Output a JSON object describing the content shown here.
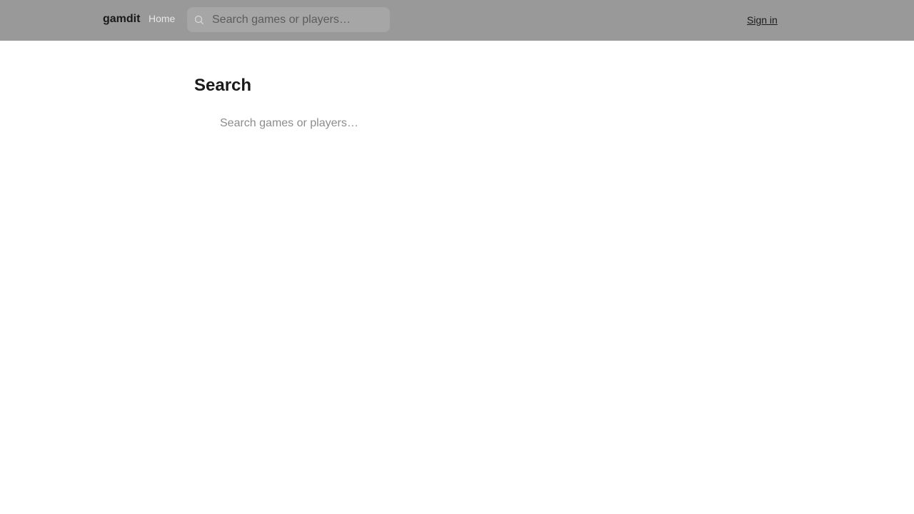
{
  "header": {
    "brand": "gamdit",
    "nav_home": "Home",
    "search": {
      "icon": "search-icon",
      "placeholder": "Search games or players…",
      "value": ""
    },
    "sign_in": "Sign in"
  },
  "main": {
    "title": "Search",
    "search": {
      "placeholder": "Search games or players…",
      "value": ""
    }
  },
  "colors": {
    "topbar_bg": "#999999",
    "text_primary": "#1a1a1a",
    "placeholder": "#8c8c8c"
  }
}
